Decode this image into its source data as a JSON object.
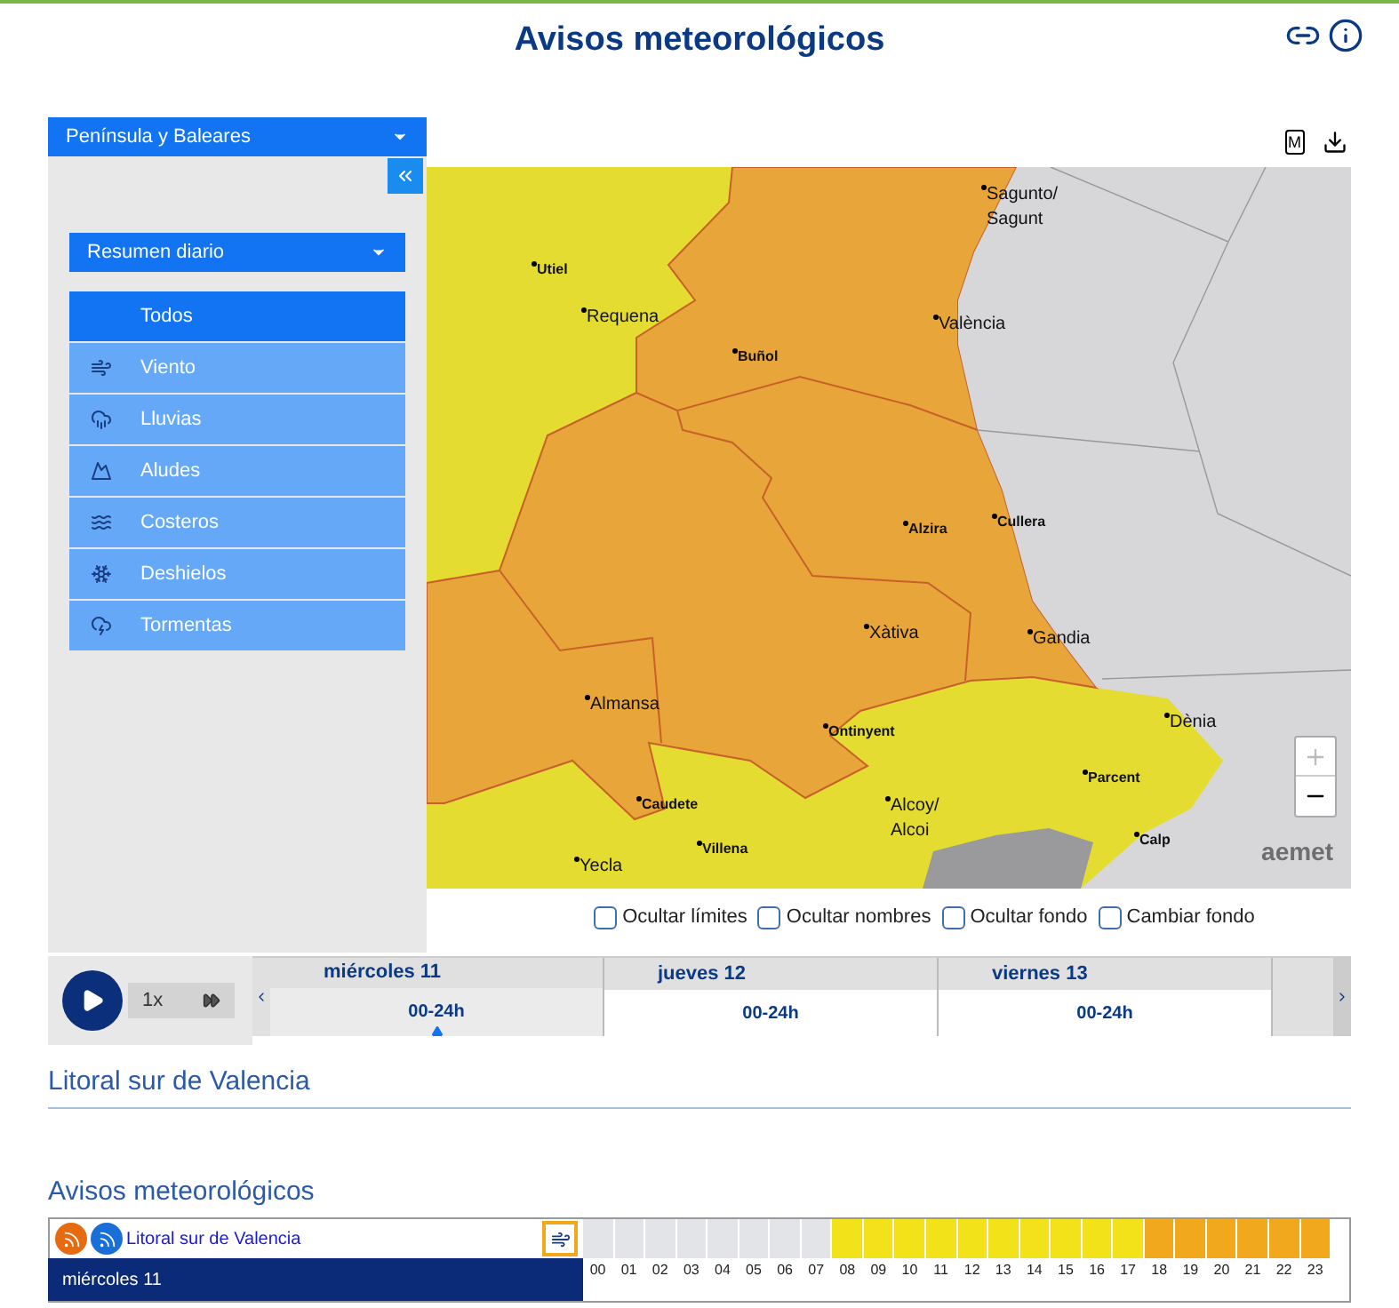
{
  "title": "Avisos meteorológicos",
  "region_select": {
    "value": "Península y Baleares"
  },
  "map_tools": {
    "m_label": "M"
  },
  "product_select": {
    "value": "Resumen diario"
  },
  "phenomena": [
    {
      "label": "Todos",
      "kind": "all",
      "selected": true
    },
    {
      "label": "Viento",
      "kind": "wind",
      "selected": false
    },
    {
      "label": "Lluvias",
      "kind": "rain",
      "selected": false
    },
    {
      "label": "Aludes",
      "kind": "avalanche",
      "selected": false
    },
    {
      "label": "Costeros",
      "kind": "coastal",
      "selected": false
    },
    {
      "label": "Deshielos",
      "kind": "thaw",
      "selected": false
    },
    {
      "label": "Tormentas",
      "kind": "storm",
      "selected": false
    }
  ],
  "map": {
    "logo": "aemet",
    "cities": [
      {
        "name": "Sagunto/\nSagunt",
        "kind": "major"
      },
      {
        "name": "Utiel",
        "kind": "minor"
      },
      {
        "name": "Requena",
        "kind": "major"
      },
      {
        "name": "Buñol",
        "kind": "minor"
      },
      {
        "name": "València",
        "kind": "major"
      },
      {
        "name": "Alzira",
        "kind": "minor"
      },
      {
        "name": "Cullera",
        "kind": "minor"
      },
      {
        "name": "Xàtiva",
        "kind": "major"
      },
      {
        "name": "Gandia",
        "kind": "major"
      },
      {
        "name": "Almansa",
        "kind": "major"
      },
      {
        "name": "Ontinyent",
        "kind": "minor"
      },
      {
        "name": "Dènia",
        "kind": "major"
      },
      {
        "name": "Caudete",
        "kind": "minor"
      },
      {
        "name": "Parcent",
        "kind": "minor"
      },
      {
        "name": "Alcoy/\nAlcoi",
        "kind": "major"
      },
      {
        "name": "Calp",
        "kind": "minor"
      },
      {
        "name": "Villena",
        "kind": "minor"
      },
      {
        "name": "Yecla",
        "kind": "major"
      }
    ]
  },
  "map_options": [
    {
      "label": "Ocultar límites",
      "checked": false
    },
    {
      "label": "Ocultar nombres",
      "checked": false
    },
    {
      "label": "Ocultar fondo",
      "checked": false
    },
    {
      "label": "Cambiar fondo",
      "checked": false
    }
  ],
  "timeline": {
    "speed": "1x",
    "days": [
      {
        "day": "miércoles 11",
        "period": "00-24h",
        "selected": true
      },
      {
        "day": "jueves 12",
        "period": "00-24h",
        "selected": false
      },
      {
        "day": "viernes 13",
        "period": "00-24h",
        "selected": false
      }
    ]
  },
  "zone_heading": "Litoral sur de Valencia",
  "warnings": {
    "heading": "Avisos meteorológicos",
    "zone_link": "Litoral sur de Valencia",
    "day": "miércoles 11",
    "hours": [
      {
        "label": "00",
        "color": "#e3e4e8"
      },
      {
        "label": "01",
        "color": "#e3e4e8"
      },
      {
        "label": "02",
        "color": "#e3e4e8"
      },
      {
        "label": "03",
        "color": "#e3e4e8"
      },
      {
        "label": "04",
        "color": "#e3e4e8"
      },
      {
        "label": "05",
        "color": "#e3e4e8"
      },
      {
        "label": "06",
        "color": "#e3e4e8"
      },
      {
        "label": "07",
        "color": "#e3e4e8"
      },
      {
        "label": "08",
        "color": "#f2e21a"
      },
      {
        "label": "09",
        "color": "#f2e21a"
      },
      {
        "label": "10",
        "color": "#f2e21a"
      },
      {
        "label": "11",
        "color": "#f2e21a"
      },
      {
        "label": "12",
        "color": "#f2e21a"
      },
      {
        "label": "13",
        "color": "#f2e21a"
      },
      {
        "label": "14",
        "color": "#f2e21a"
      },
      {
        "label": "15",
        "color": "#f2e21a"
      },
      {
        "label": "16",
        "color": "#f2e21a"
      },
      {
        "label": "17",
        "color": "#f2e21a"
      },
      {
        "label": "18",
        "color": "#f2a81d"
      },
      {
        "label": "19",
        "color": "#f2a81d"
      },
      {
        "label": "20",
        "color": "#f2a81d"
      },
      {
        "label": "21",
        "color": "#f2a81d"
      },
      {
        "label": "22",
        "color": "#f2a81d"
      },
      {
        "label": "23",
        "color": "#f2a81d"
      }
    ]
  }
}
